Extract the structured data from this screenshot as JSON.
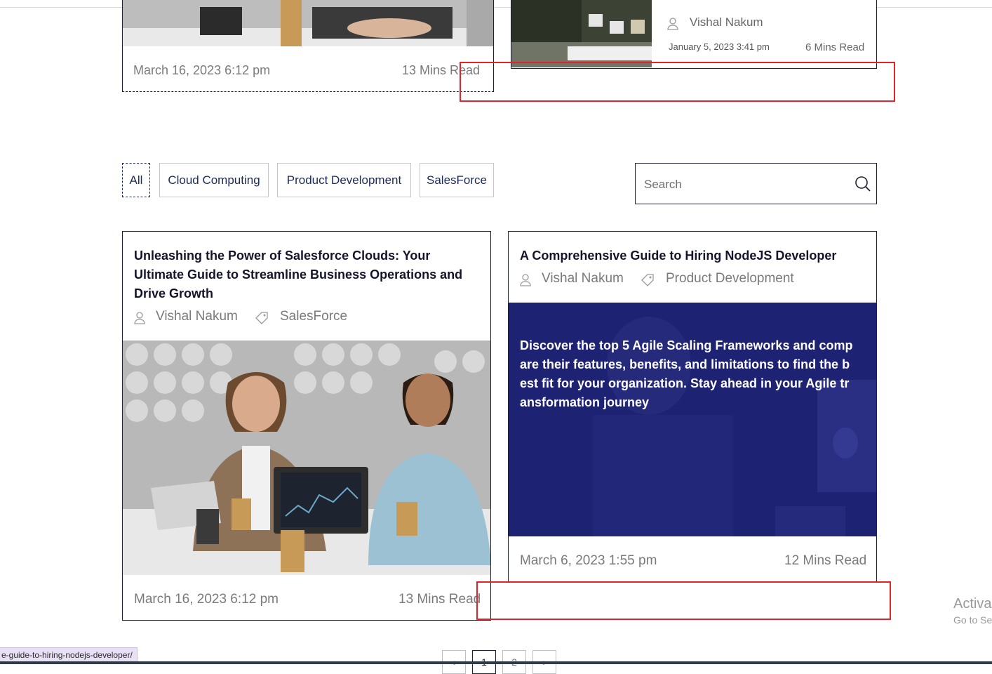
{
  "top_cards": [
    {
      "date": "March 16, 2023  6:12 pm",
      "read_time": "13 Mins Read"
    },
    {
      "author": "Vishal Nakum",
      "date": "January 5, 2023   3:41 pm",
      "read_time": "6 Mins Read"
    }
  ],
  "filters": {
    "items": [
      "All",
      "Cloud Computing",
      "Product Development",
      "SalesForce"
    ],
    "active": "All"
  },
  "search": {
    "placeholder": "Search"
  },
  "posts": [
    {
      "title": "Unleashing the Power of Salesforce Clouds: Your Ultimate Guide to Streamline Business Operations and Drive Growth",
      "author": "Vishal Nakum",
      "category": "SalesForce",
      "date": "March 16, 2023  6:12 pm",
      "read_time": "13 Mins Read"
    },
    {
      "title": "A Comprehensive Guide to Hiring NodeJS Developer",
      "author": "Vishal Nakum",
      "category": "Product Development",
      "excerpt": "Discover the top 5 Agile Scaling Frameworks and comp are their features, benefits, and limitations to find the b est fit for your organization. Stay ahead in your Agile tr ansformation journey",
      "date": "March 6, 2023  1:55 pm",
      "read_time": "12 Mins Read"
    }
  ],
  "pagination": {
    "prev": "‹",
    "pages": [
      "1",
      "2"
    ],
    "current": "1",
    "next": "›"
  },
  "status_url": "e-guide-to-hiring-nodejs-developer/",
  "windows_watermark": {
    "line1": "Activa",
    "line2": "Go to Se"
  },
  "colors": {
    "accent_navy": "#1b2a5a",
    "overlay": "#1c1f6e",
    "highlight_red": "#e2232a"
  }
}
